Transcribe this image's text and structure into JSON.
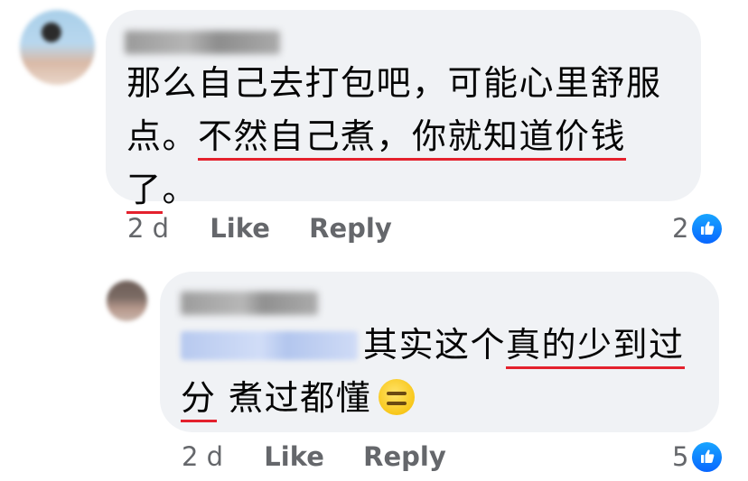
{
  "comments": [
    {
      "author": "Dayly Pfeut",
      "text_lines": [
        {
          "segments": [
            {
              "t": "那么自己去打包吧，可能心里舒服",
              "u": false
            }
          ]
        },
        {
          "segments": [
            {
              "t": "点。",
              "u": false
            },
            {
              "t": "不然自己煮，你就知道价钱",
              "u": true
            }
          ]
        },
        {
          "segments": [
            {
              "t": "了",
              "u": true
            },
            {
              "t": "。",
              "u": false
            }
          ]
        }
      ],
      "time": "2 d",
      "like_label": "Like",
      "reply_label": "Reply",
      "reaction_count": "2",
      "reaction_icon": "thumbs-up-icon"
    },
    {
      "author": "Chin Rou",
      "mention": "Dayly Pfeut",
      "text_lines": [
        {
          "segments": [
            {
              "t": "其实这个",
              "u": false
            },
            {
              "t": "真的少到过",
              "u": true
            }
          ]
        },
        {
          "segments": [
            {
              "t": "分",
              "u": true
            },
            {
              "t": " 煮过都懂",
              "u": false
            }
          ]
        }
      ],
      "emoji": "expressionless-face-emoji",
      "time": "2 d",
      "like_label": "Like",
      "reply_label": "Reply",
      "reaction_count": "5",
      "reaction_icon": "thumbs-up-icon"
    }
  ],
  "colors": {
    "bubble_bg": "#f0f2f5",
    "underline": "#e4212d",
    "meta_text": "#65676b",
    "like_blue": "#0866ff"
  }
}
